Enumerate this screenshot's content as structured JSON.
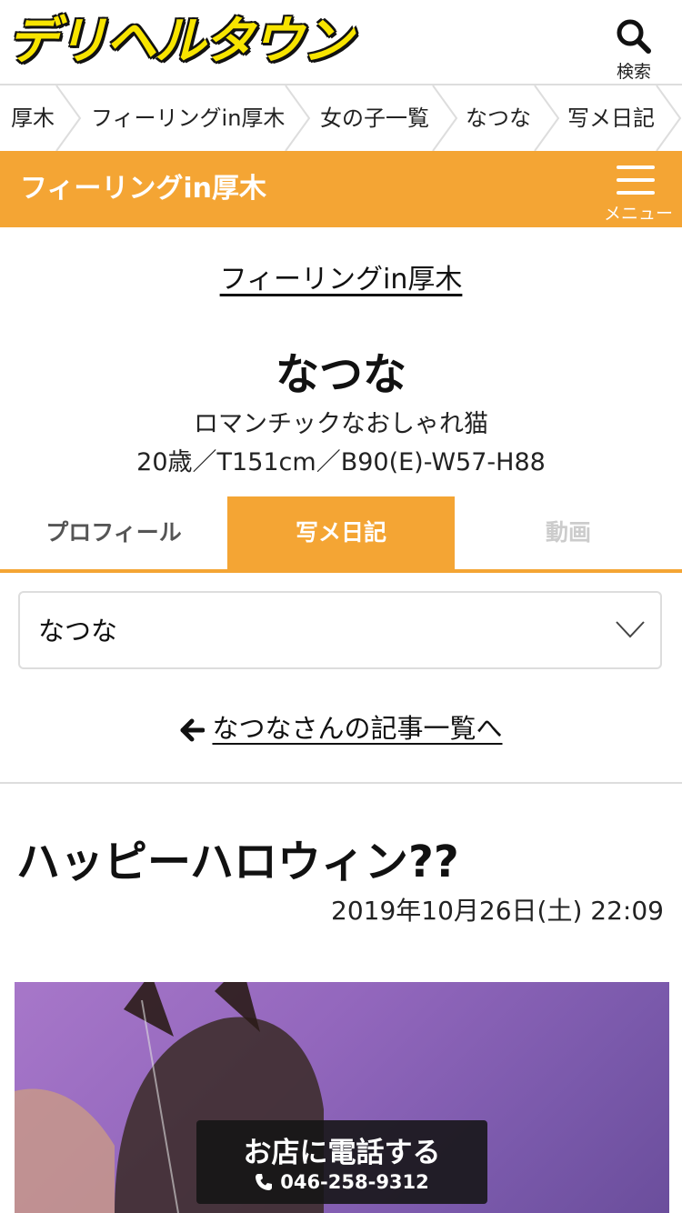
{
  "header": {
    "logo_text": "デリヘルタウン",
    "search_label": "検索"
  },
  "breadcrumb": [
    "厚木",
    "フィーリングin厚木",
    "女の子一覧",
    "なつな",
    "写メ日記"
  ],
  "shop_bar": {
    "title": "フィーリングin厚木",
    "menu_label": "メニュー"
  },
  "profile": {
    "shop_link": "フィーリングin厚木",
    "name": "なつな",
    "catch": "ロマンチックなおしゃれ猫",
    "spec": "20歳／T151cm／B90(E)-W57-H88"
  },
  "tabs": {
    "profile": "プロフィール",
    "diary": "写メ日記",
    "movie": "動画"
  },
  "select": {
    "value": "なつな"
  },
  "back_link": "なつなさんの記事一覧へ",
  "post": {
    "title": "ハッピーハロウィン??",
    "date": "2019年10月26日(土) 22:09"
  },
  "call": {
    "title": "お店に電話する",
    "tel": "046-258-9312"
  },
  "colors": {
    "accent": "#f4a534",
    "logo_yellow": "#f7e400"
  }
}
